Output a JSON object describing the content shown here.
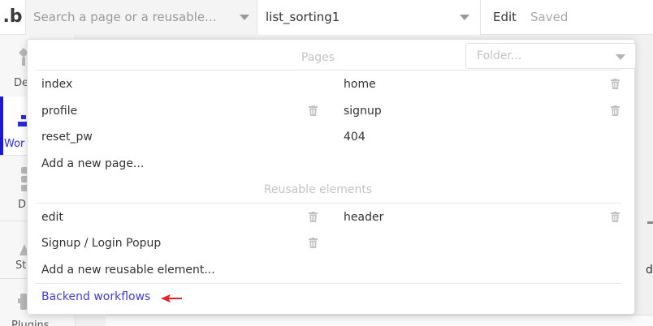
{
  "topbar": {
    "logo_text": ".b",
    "page_search_placeholder": "Search a page or a reusable...",
    "current_page": "list_sorting1",
    "edit_label": "Edit",
    "saved_label": "Saved"
  },
  "sidebar": {
    "items": [
      {
        "label": "De",
        "icon": "design-icon"
      },
      {
        "label": "Wor",
        "icon": "workflow-icon",
        "active": true
      },
      {
        "label": "D",
        "icon": "data-icon"
      },
      {
        "label": "St",
        "icon": "styles-icon"
      },
      {
        "label": "Plugins",
        "icon": "plugins-icon"
      }
    ]
  },
  "canvas": {
    "edge_letter": "d"
  },
  "panel": {
    "pages_title": "Pages",
    "folder_placeholder": "Folder...",
    "pages": [
      {
        "name": "index",
        "deletable": false
      },
      {
        "name": "home",
        "deletable": true
      },
      {
        "name": "profile",
        "deletable": true
      },
      {
        "name": "signup",
        "deletable": true
      },
      {
        "name": "reset_pw",
        "deletable": false
      },
      {
        "name": "404",
        "deletable": false
      }
    ],
    "add_page_label": "Add a new page...",
    "reusables_title": "Reusable elements",
    "reusables": [
      {
        "name": "edit",
        "deletable": true
      },
      {
        "name": "header",
        "deletable": true
      },
      {
        "name": "Signup / Login Popup",
        "deletable": true
      }
    ],
    "add_reusable_label": "Add a new reusable element...",
    "backend_label": "Backend workflows"
  },
  "colors": {
    "accent": "#3f3fce",
    "active_bar": "#1a1ad6",
    "arrow": "#e8202a",
    "muted": "#c4c4c4"
  }
}
